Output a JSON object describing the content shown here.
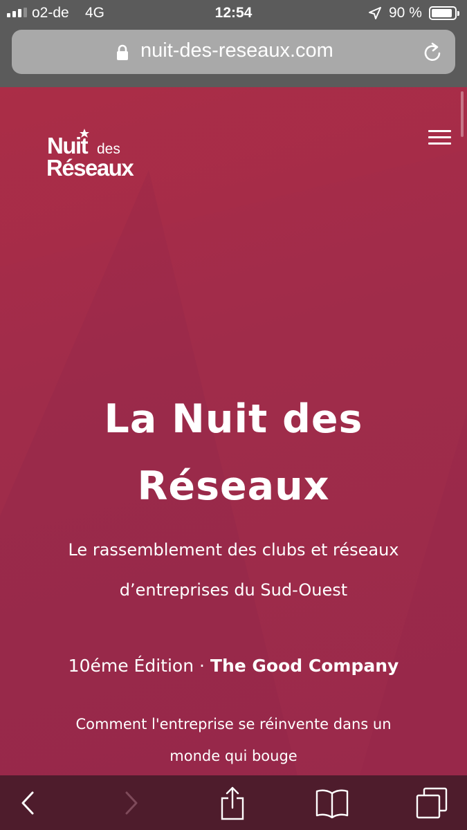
{
  "status_bar": {
    "carrier": "o2-de",
    "network": "4G",
    "time": "12:54",
    "battery_percent": "90 %",
    "battery_level": 0.9,
    "signal_bars_filled": 3,
    "signal_bars_total": 4,
    "icons": [
      "signal-icon",
      "location-arrow-icon",
      "battery-icon"
    ]
  },
  "browser": {
    "url": "nuit-des-reseaux.com",
    "icons": [
      "lock-icon",
      "reload-icon"
    ]
  },
  "header": {
    "logo": {
      "line1_main": "Nuit",
      "line1_small": "des",
      "line2": "Réseaux"
    },
    "menu_icon": "hamburger-menu-icon"
  },
  "hero": {
    "title_line1": "La Nuit des",
    "title_line2": "Réseaux",
    "subtitle_line1": "Le rassemblement des clubs et réseaux",
    "subtitle_line2": "d’entreprises du Sud-Ouest",
    "edition_number": "10éme Édition",
    "edition_separator": "·",
    "edition_name": "The Good Company",
    "tagline_line1": "Comment l'entreprise se réinvente dans un",
    "tagline_line2": "monde qui bouge"
  },
  "toolbar": {
    "icons": [
      "back-icon",
      "forward-icon",
      "share-icon",
      "bookmarks-icon",
      "tabs-icon"
    ]
  },
  "colors": {
    "page_background": "#a02c4a",
    "status_bar": "#5b5b5b",
    "address_bar": "#a9a9a9",
    "toolbar": "#4e1c2c",
    "text": "#ffffff"
  }
}
